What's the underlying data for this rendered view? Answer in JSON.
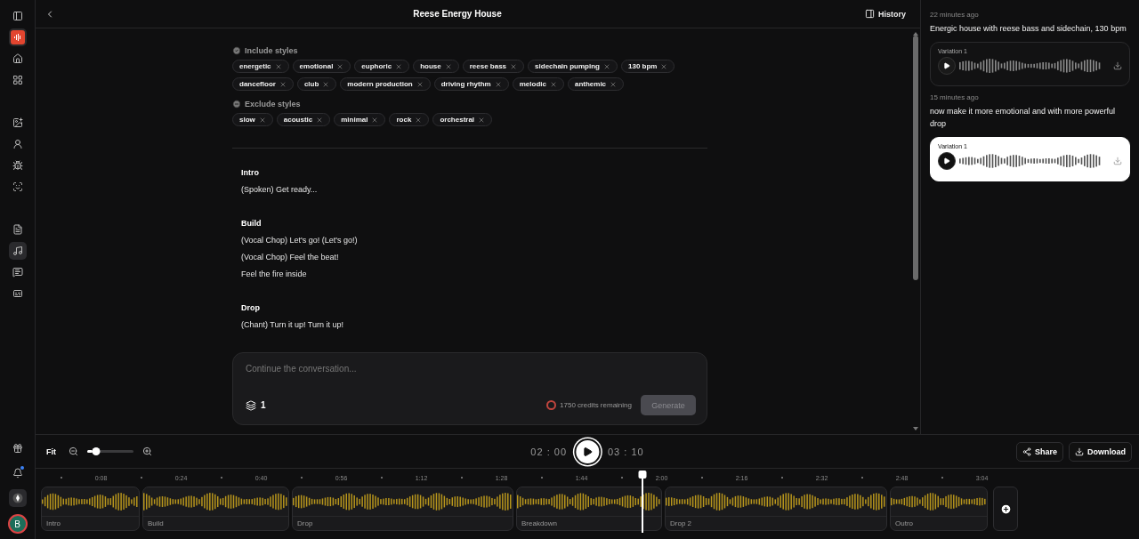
{
  "sidebar": {
    "groups": [
      {
        "items": [
          {
            "selected": false
          },
          {
            "selected": false
          },
          {
            "selected": false
          },
          {
            "selected": false
          }
        ]
      },
      {
        "items": [
          {
            "selected": false
          },
          {
            "selected": false
          },
          {
            "selected": false
          },
          {
            "selected": false
          }
        ]
      },
      {
        "items": [
          {
            "selected": false
          },
          {
            "selected": true
          },
          {
            "selected": false
          },
          {
            "selected": false
          }
        ]
      }
    ],
    "notification_badge": true,
    "avatar": "B"
  },
  "header": {
    "title": "Reese Energy House",
    "history_button": "History"
  },
  "include_styles": {
    "label": "Include styles",
    "tags": [
      "energetic",
      "emotional",
      "euphoric",
      "house",
      "reese bass",
      "sidechain pumping",
      "130 bpm",
      "dancefloor",
      "club",
      "modern production",
      "driving rhythm",
      "melodic",
      "anthemic"
    ]
  },
  "exclude_styles": {
    "label": "Exclude styles",
    "tags": [
      "slow",
      "acoustic",
      "minimal",
      "rock",
      "orchestral"
    ]
  },
  "lyrics": [
    {
      "heading": "Intro",
      "lines": [
        "(Spoken) Get ready..."
      ]
    },
    {
      "heading": "Build",
      "lines": [
        "(Vocal Chop) Let's go! (Let's go!)",
        "(Vocal Chop) Feel the beat!",
        "Feel the fire inside"
      ]
    },
    {
      "heading": "Drop",
      "lines": [
        "(Chant) Turn it up! Turn it up!"
      ]
    }
  ],
  "composer": {
    "placeholder": "Continue the conversation...",
    "variations": "1",
    "credits": "1750 credits remaining",
    "generate_button": "Generate",
    "generate_disabled": true
  },
  "history": [
    {
      "time": "22 minutes ago",
      "prompt": "Energic house with reese bass and sidechain, 130 bpm",
      "variations": [
        {
          "label": "Variation 1",
          "selected": false
        }
      ]
    },
    {
      "time": "15 minutes ago",
      "prompt": "now make it more emotional and with more powerful drop",
      "variations": [
        {
          "label": "Variation 1",
          "selected": true
        }
      ]
    }
  ],
  "player": {
    "fit": "Fit",
    "zoom": {
      "level": 0.2
    },
    "current_time": "02 : 00",
    "total_time": "03 : 10",
    "share": "Share",
    "download": "Download"
  },
  "timeline": {
    "ticks": [
      "0:08",
      "0:24",
      "0:40",
      "0:56",
      "1:12",
      "1:28",
      "1:44",
      "2:00",
      "2:16",
      "2:32",
      "2:48",
      "3:04"
    ],
    "playhead": {
      "level": 0.55
    },
    "segments": [
      "Intro",
      "Build",
      "Drop",
      "Breakdown",
      "Drop 2",
      "Outro"
    ]
  }
}
